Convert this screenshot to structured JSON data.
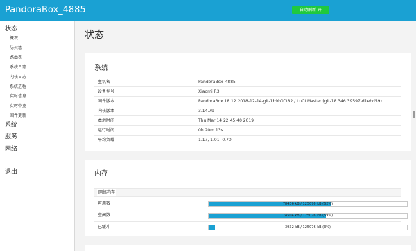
{
  "header": {
    "brand": "PandoraBox_4885",
    "auto_refresh_label": "自动刷新 开"
  },
  "sidebar": {
    "status": "状态",
    "status_items": [
      "概况",
      "防火墙",
      "路由表",
      "系统日志",
      "内核日志",
      "系统进程",
      "实时信息",
      "实时带宽",
      "固件更新"
    ],
    "active_index": 0,
    "system": "系统",
    "services": "服务",
    "network": "网络",
    "logout": "退出"
  },
  "main": {
    "page_title": "状态",
    "system_card": {
      "title": "系统",
      "rows": [
        {
          "key": "主机名",
          "value": "PandoraBox_4885"
        },
        {
          "key": "设备型号",
          "value": "Xiaomi R3"
        },
        {
          "key": "固件版本",
          "value": "PandoraBox 18.12 2018-12-14-git-1b9b0f382 / LuCI Master (git-18.346.39597-d1ebd59)"
        },
        {
          "key": "内核版本",
          "value": "3.14.79"
        },
        {
          "key": "本地时间",
          "value": "Thu Mar 14 22:45:40 2019"
        },
        {
          "key": "运行时间",
          "value": "0h 20m 13s"
        },
        {
          "key": "平均负载",
          "value": "1.17, 1.01, 0.70"
        }
      ]
    },
    "memory_card": {
      "title": "内存",
      "section_label": "网络内存",
      "rows": [
        {
          "key": "可用数",
          "value": "78436 kB / 125076 kB (62%)",
          "fraction": 0.62
        },
        {
          "key": "空闲数",
          "value": "74504 kB / 125076 kB (59%)",
          "fraction": 0.59
        },
        {
          "key": "已缓冲",
          "value": "3932 kB / 125076 kB (3%)",
          "fraction": 0.03
        }
      ]
    }
  },
  "colors": {
    "accent": "#1aa1d3",
    "refresh_button": "#20c93d"
  }
}
